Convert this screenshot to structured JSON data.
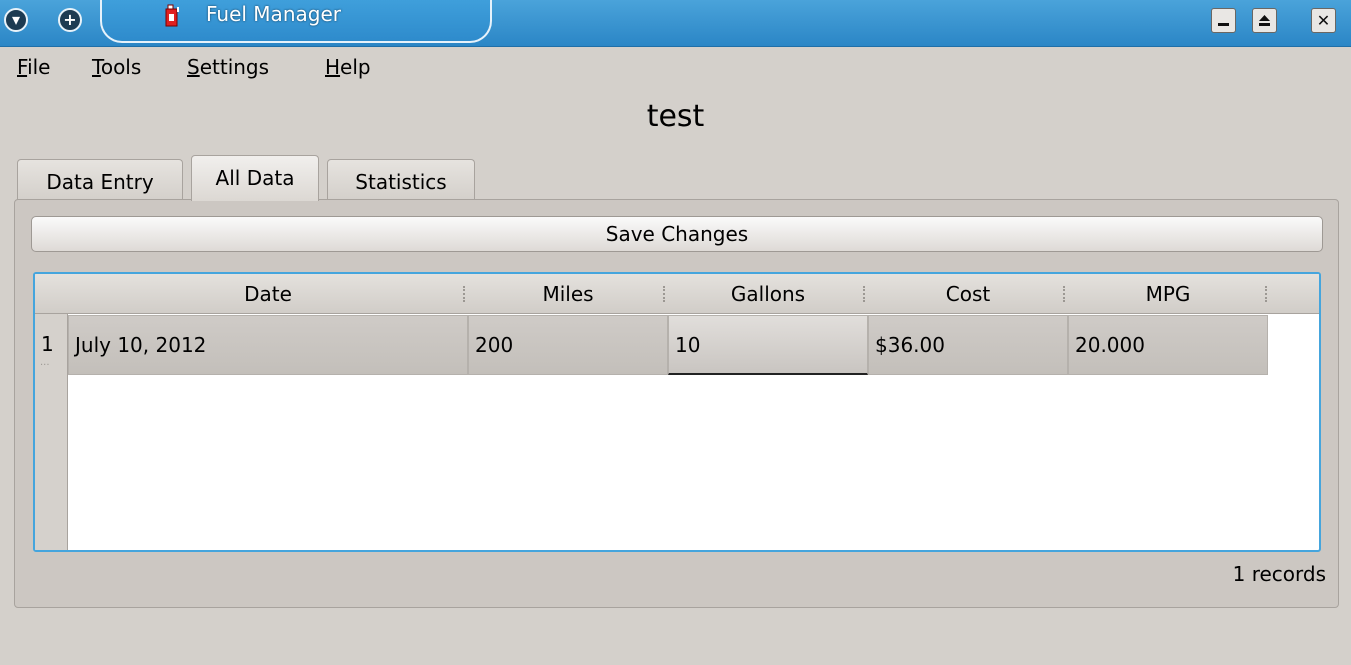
{
  "titlebar": {
    "title": "Fuel Manager",
    "menu_icon": "chevron-down-icon",
    "plus_icon": "plus-icon",
    "app_icon": "fuel-can-icon",
    "minimize_icon": "minimize-icon",
    "maximize_icon": "maximize-icon",
    "close_icon": "close-icon"
  },
  "menubar": {
    "items": [
      {
        "mnemonic": "F",
        "rest": "ile"
      },
      {
        "mnemonic": "T",
        "rest": "ools"
      },
      {
        "mnemonic": "S",
        "rest": "ettings"
      },
      {
        "mnemonic": "H",
        "rest": "elp"
      }
    ]
  },
  "document": {
    "title": "test"
  },
  "tabs": [
    {
      "label": "Data Entry",
      "active": false
    },
    {
      "label": "All Data",
      "active": true
    },
    {
      "label": "Statistics",
      "active": false
    }
  ],
  "panel": {
    "save_label": "Save Changes",
    "status": "1 records"
  },
  "table": {
    "columns": [
      "Date",
      "Miles",
      "Gallons",
      "Cost",
      "MPG"
    ],
    "rows": [
      {
        "index": "1",
        "cells": [
          "July 10, 2012",
          "200",
          "10",
          "$36.00",
          "20.000"
        ]
      }
    ],
    "editing_cell": {
      "row": 0,
      "col": 2
    }
  },
  "colors": {
    "titlebar": "#2b86c6",
    "focus_border": "#45a5dd",
    "window_bg": "#d4d0cb"
  }
}
